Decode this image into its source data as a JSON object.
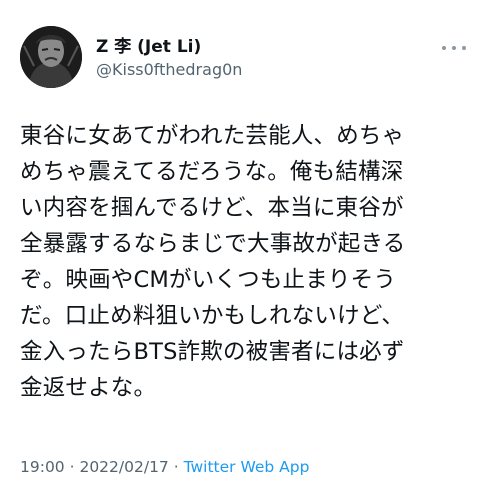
{
  "user": {
    "display_name": "Z 李 (Jet Li)",
    "handle": "@Kiss0fthedrag0n"
  },
  "tweet": {
    "text": "東谷に女あてがわれた芸能人、めちゃ\nめちゃ震えてるだろうな。俺も結構深\nい内容を掴んでるけど、本当に東谷が\n全暴露するならまじで大事故が起きる\nぞ。映画やCMがいくつも止まりそう\nだ。口止め料狙いかもしれないけど、\n金入ったらBTS詐欺の被害者には必ず\n金返せよな。",
    "time": "19:00",
    "sep1": " · ",
    "date": "2022/02/17",
    "sep2": " · ",
    "source": "Twitter Web App"
  },
  "icons": {
    "more": "more-options-icon",
    "avatar": "avatar"
  },
  "colors": {
    "text": "#0f1419",
    "secondary": "#536471",
    "link": "#1d9bf0"
  }
}
